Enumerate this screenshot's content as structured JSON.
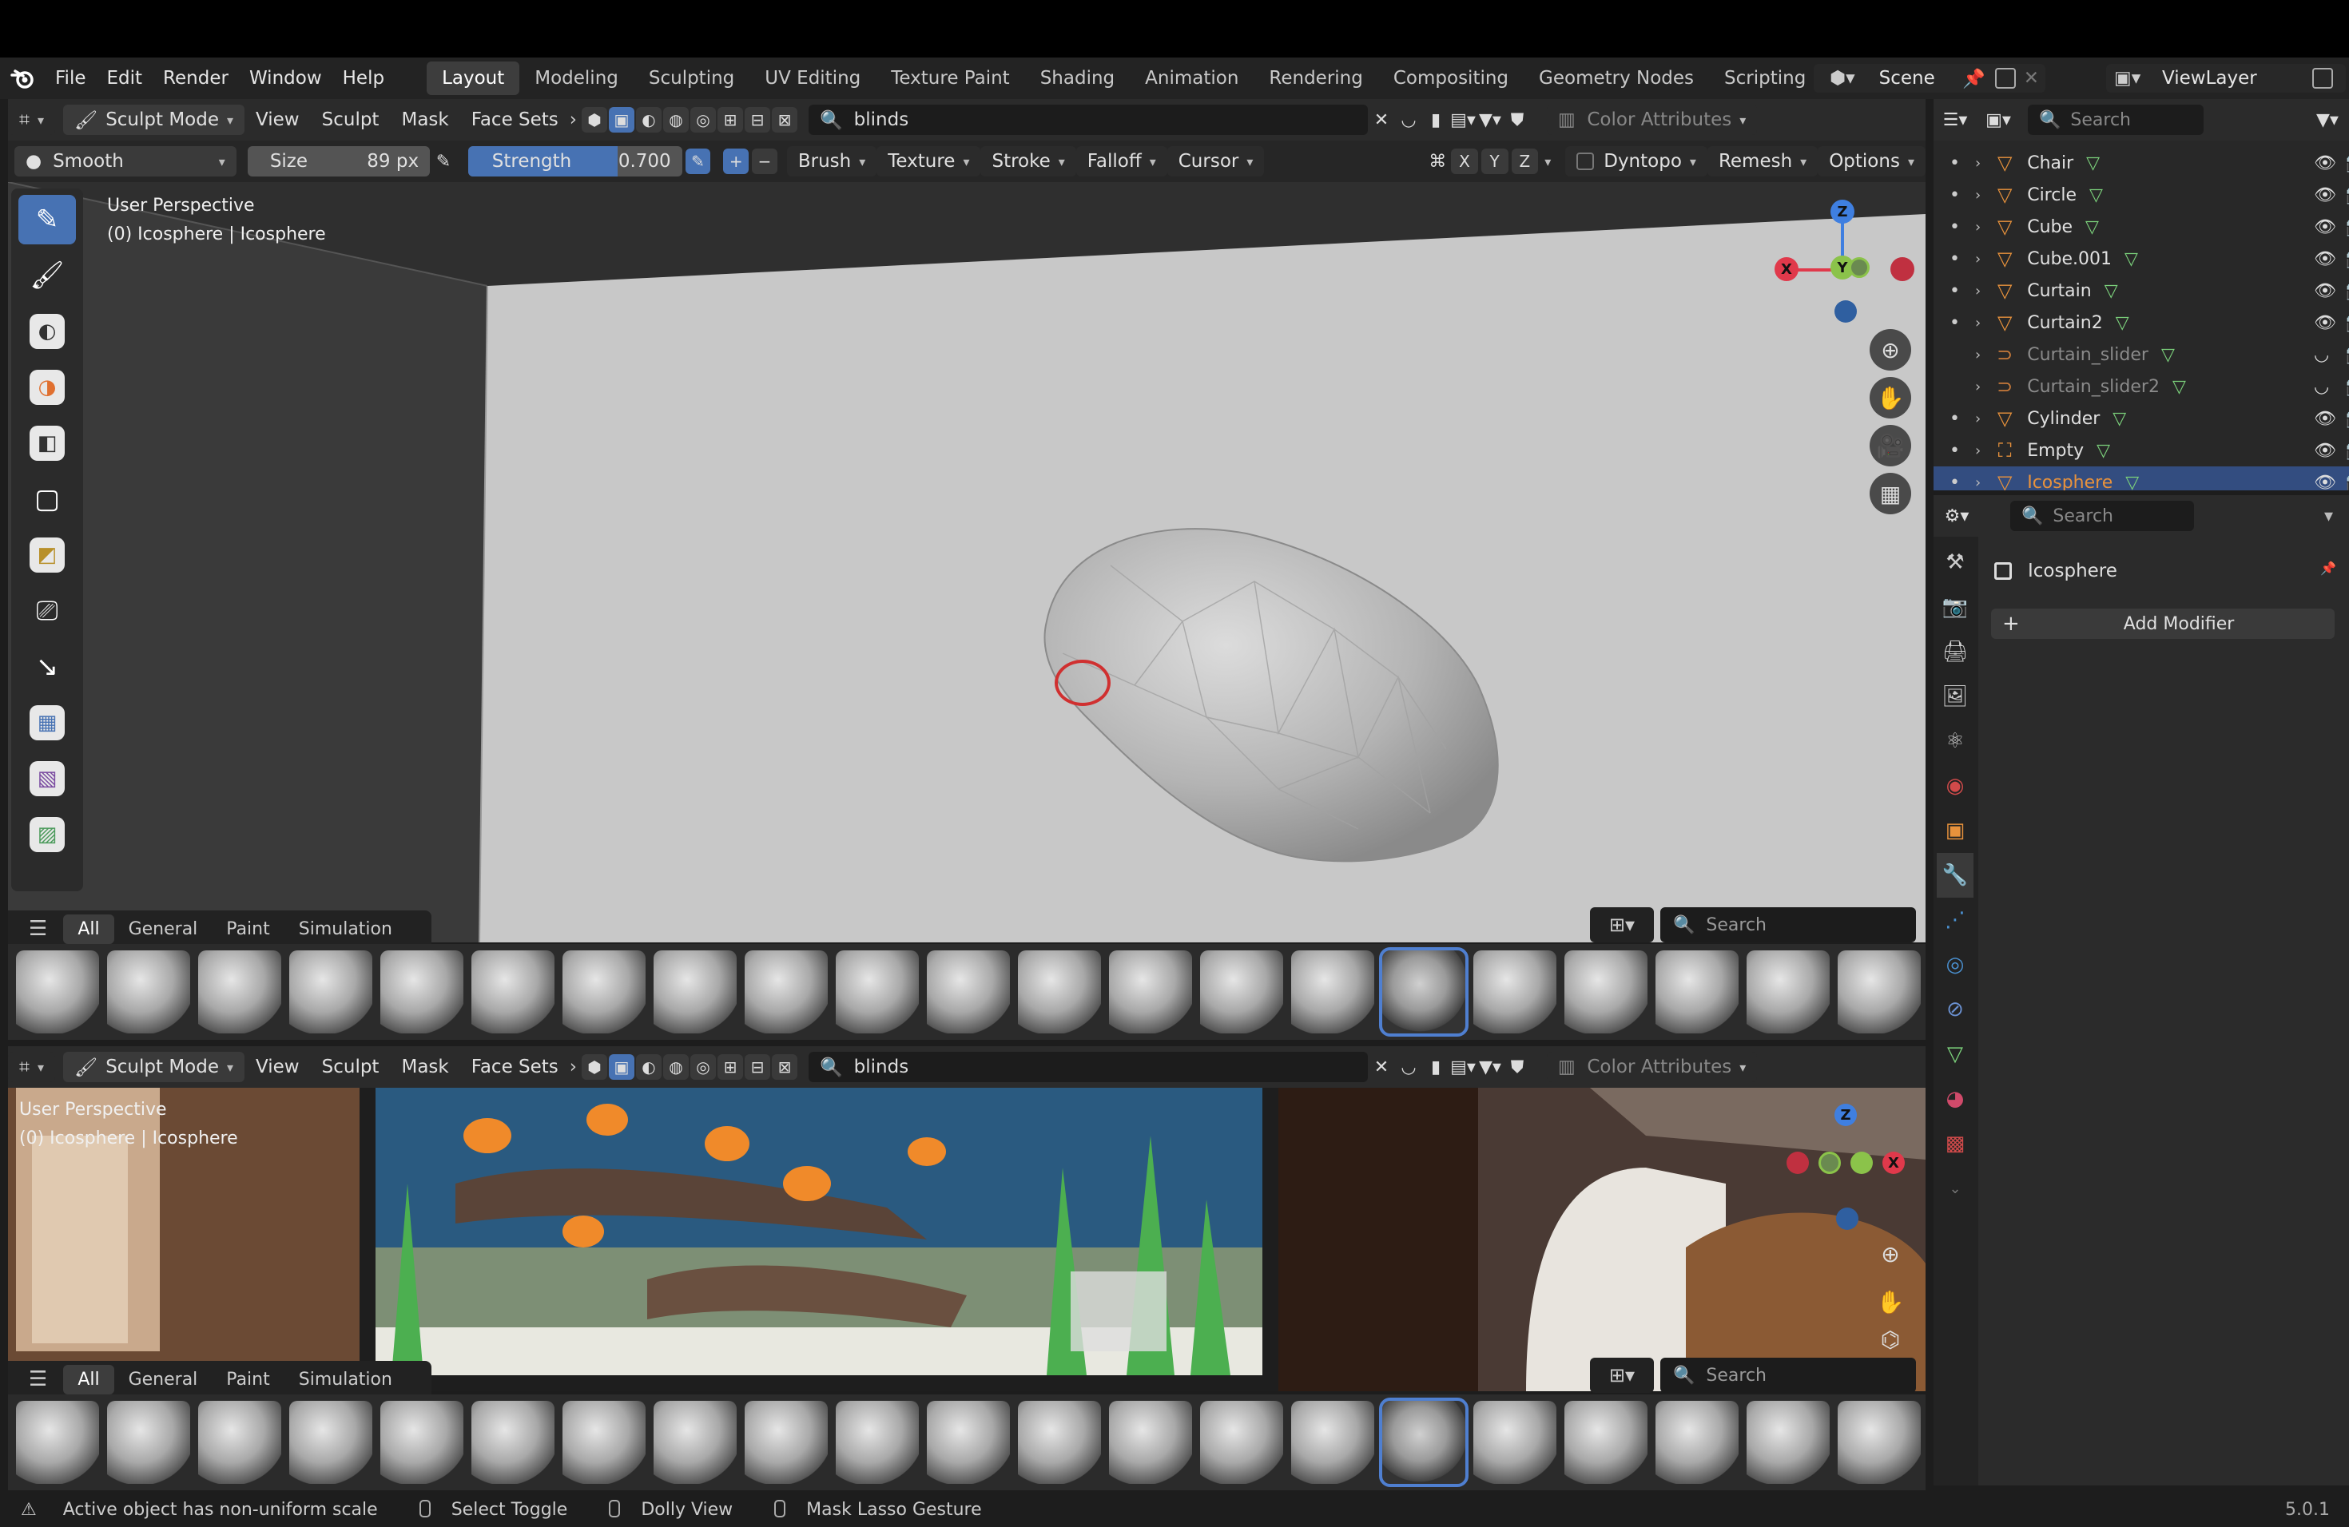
{
  "app": {
    "menu": [
      "File",
      "Edit",
      "Render",
      "Window",
      "Help"
    ],
    "workspaces": [
      "Layout",
      "Modeling",
      "Sculpting",
      "UV Editing",
      "Texture Paint",
      "Shading",
      "Animation",
      "Rendering",
      "Compositing",
      "Geometry Nodes",
      "Scripting"
    ],
    "active_workspace": "Layout",
    "scene": "Scene",
    "view_layer": "ViewLayer",
    "version": "5.0.1"
  },
  "viewport_top": {
    "mode": "Sculpt Mode",
    "menus": [
      "View",
      "Sculpt",
      "Mask",
      "Face Sets"
    ],
    "search_value": "blinds",
    "color_attributes": "Color Attributes",
    "tool_settings": {
      "brush_name": "Smooth",
      "size_label": "Size",
      "size_value": "89 px",
      "strength_label": "Strength",
      "strength_value": "0.700",
      "strength_fraction": 0.7,
      "dropdowns": [
        "Brush",
        "Texture",
        "Stroke",
        "Falloff",
        "Cursor"
      ],
      "axes": [
        "X",
        "Y",
        "Z"
      ],
      "dyntopo": "Dyntopo",
      "remesh": "Remesh",
      "options": "Options"
    },
    "overlay_line1": "User Perspective",
    "overlay_line2": "(0) Icosphere | Icosphere"
  },
  "viewport_bottom": {
    "mode": "Sculpt Mode",
    "menus": [
      "View",
      "Sculpt",
      "Mask",
      "Face Sets"
    ],
    "search_value": "blinds",
    "color_attributes": "Color Attributes",
    "overlay_line1": "User Perspective",
    "overlay_line2": "(0) Icosphere | Icosphere"
  },
  "shelf": {
    "tabs": [
      "All",
      "General",
      "Paint",
      "Simulation"
    ],
    "active_tab": "All",
    "search_placeholder": "Search",
    "brush_count": 21,
    "active_index": 15
  },
  "gizmo": {
    "z": "Z",
    "y": "Y",
    "x": "X"
  },
  "outliner": {
    "search_placeholder": "Search",
    "items": [
      {
        "name": "Chair",
        "type": "mesh",
        "dim": false
      },
      {
        "name": "Circle",
        "type": "mesh",
        "dim": false
      },
      {
        "name": "Cube",
        "type": "mesh",
        "dim": false
      },
      {
        "name": "Cube.001",
        "type": "mesh",
        "dim": false
      },
      {
        "name": "Curtain",
        "type": "mesh",
        "dim": false
      },
      {
        "name": "Curtain2",
        "type": "mesh",
        "dim": false
      },
      {
        "name": "Curtain_slider",
        "type": "curve",
        "dim": true
      },
      {
        "name": "Curtain_slider2",
        "type": "curve",
        "dim": true
      },
      {
        "name": "Cylinder",
        "type": "mesh",
        "dim": false
      },
      {
        "name": "Empty",
        "type": "empty",
        "dim": false
      },
      {
        "name": "Icosphere",
        "type": "mesh",
        "dim": false,
        "selected": true
      }
    ]
  },
  "properties": {
    "search_placeholder": "Search",
    "object_name": "Icosphere",
    "add_modifier": "Add Modifier"
  },
  "status": {
    "items": [
      "Active object has non-uniform scale",
      "Select Toggle",
      "Dolly View",
      "Mask Lasso Gesture"
    ]
  },
  "colors": {
    "accent": "#4772b3",
    "x_axis": "#e0394b",
    "y_axis": "#8bc34a",
    "z_axis": "#3f7fe0"
  }
}
